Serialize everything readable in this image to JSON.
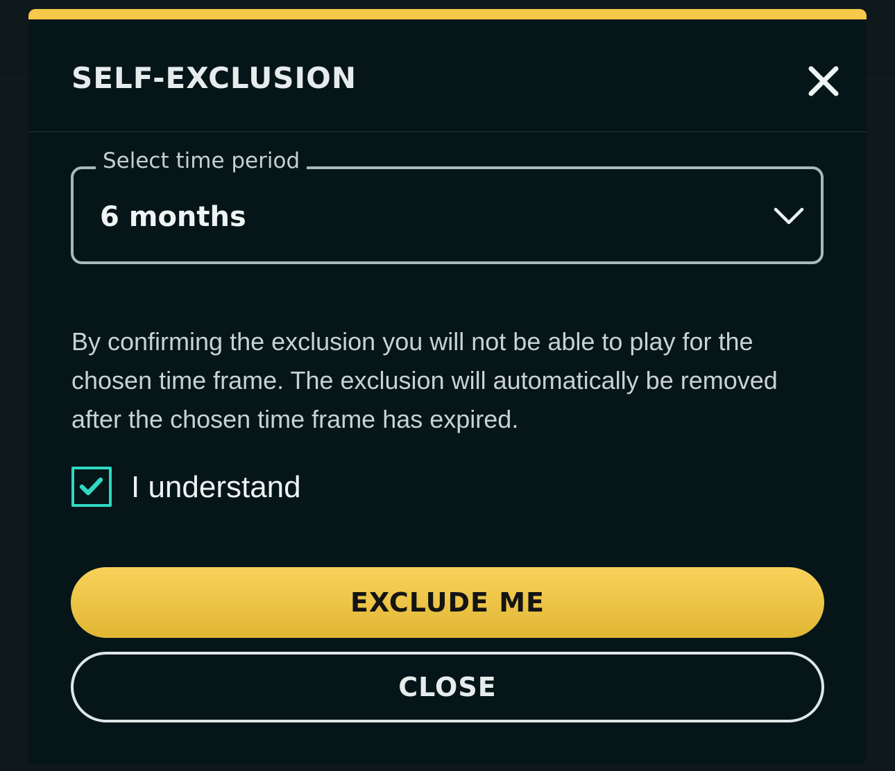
{
  "modal": {
    "title": "SELF-EXCLUSION",
    "accent_color": "#f7c948",
    "close_icon": "close-icon"
  },
  "time_period": {
    "legend": "Select time period",
    "value": "6 months",
    "icon": "chevron-down-icon"
  },
  "description": "By confirming the exclusion you will not be able to play for the chosen time frame. The exclusion will automatically be removed after the chosen time frame has expired.",
  "confirm": {
    "label": "I understand",
    "checked": true,
    "check_color": "#2fd9c4"
  },
  "buttons": {
    "exclude_label": "EXCLUDE ME",
    "close_label": "CLOSE"
  }
}
